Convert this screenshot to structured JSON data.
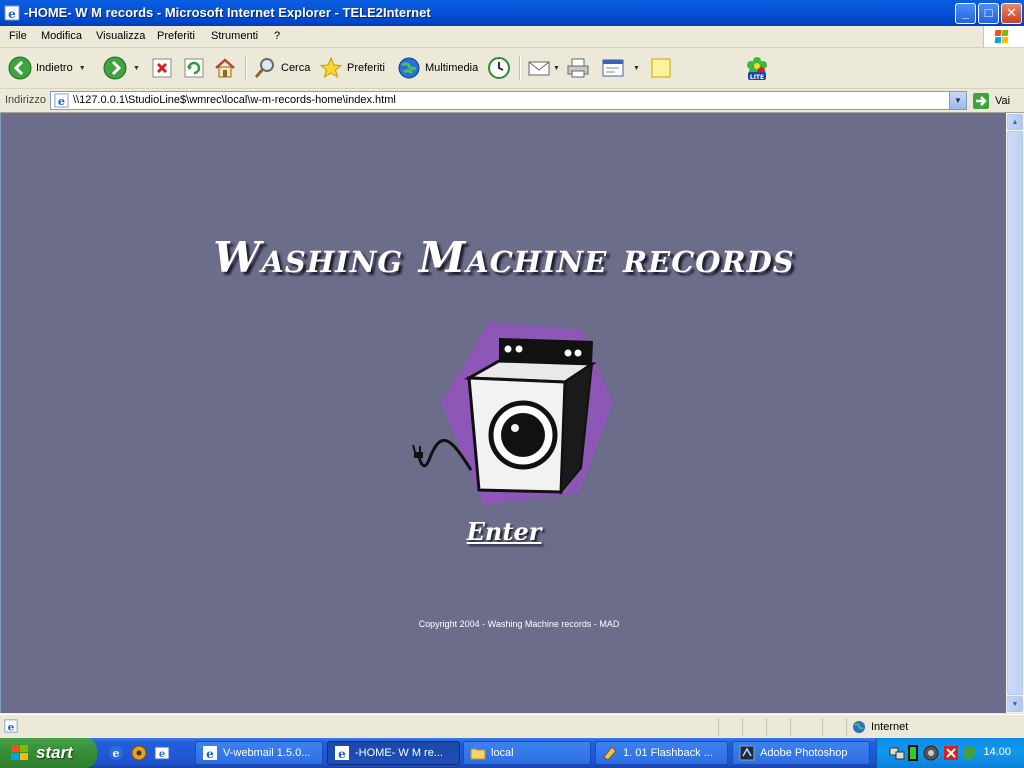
{
  "window": {
    "title": "-HOME- W M records - Microsoft Internet Explorer - TELE2Internet",
    "minimize": "_",
    "maximize": "□",
    "close": "✕"
  },
  "menu": [
    "File",
    "Modifica",
    "Visualizza",
    "Preferiti",
    "Strumenti",
    "?"
  ],
  "toolbar": {
    "back": "Indietro",
    "search": "Cerca",
    "favorites": "Preferiti",
    "media": "Multimedia"
  },
  "address": {
    "label": "Indirizzo",
    "url": "\\\\127.0.0.1\\StudioLine$\\wmrec\\local\\w-m-records-home\\index.html",
    "go": "Vai"
  },
  "page": {
    "title": "Washing Machine records",
    "enter": "Enter",
    "copyright": "Copyright 2004 - Washing Machine records -    MAD"
  },
  "status": {
    "zone": "Internet"
  },
  "taskbar": {
    "start": "start",
    "tasks": [
      "V-webmail 1.5.0...",
      "-HOME- W M re...",
      "local",
      "1. 01 Flashback ...",
      "Adobe Photoshop"
    ],
    "clock": "14.00"
  },
  "colors": {
    "page_background": "#6C6D8B",
    "washer_hexagon": "#8E56B6",
    "titlebar": "#0553D8"
  }
}
